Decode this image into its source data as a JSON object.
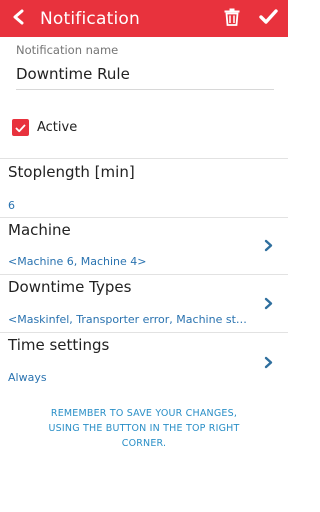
{
  "header": {
    "title": "Notification",
    "back_icon": "back-arrow-icon",
    "delete_icon": "trash-icon",
    "save_icon": "checkmark-icon",
    "background_color": "#e8323d"
  },
  "form": {
    "name_label": "Notification name",
    "name_value": "Downtime Rule",
    "active_label": "Active",
    "active_checked": true
  },
  "sections": [
    {
      "title": "Stoplength [min]",
      "value": "6",
      "has_chevron": false
    },
    {
      "title": "Machine",
      "value": "<Machine 6, Machine 4>",
      "has_chevron": true
    },
    {
      "title": "Downtime Types",
      "value": "<Maskinfel, Transporter error, Machine st…",
      "has_chevron": true
    },
    {
      "title": "Time settings",
      "value": "Always",
      "has_chevron": true
    }
  ],
  "notice": "REMEMBER TO SAVE YOUR CHANGES, USING THE BUTTON IN THE TOP RIGHT CORNER.",
  "colors": {
    "accent": "#e8323d",
    "link": "#2a73b0",
    "notice": "#2a8fc7"
  }
}
